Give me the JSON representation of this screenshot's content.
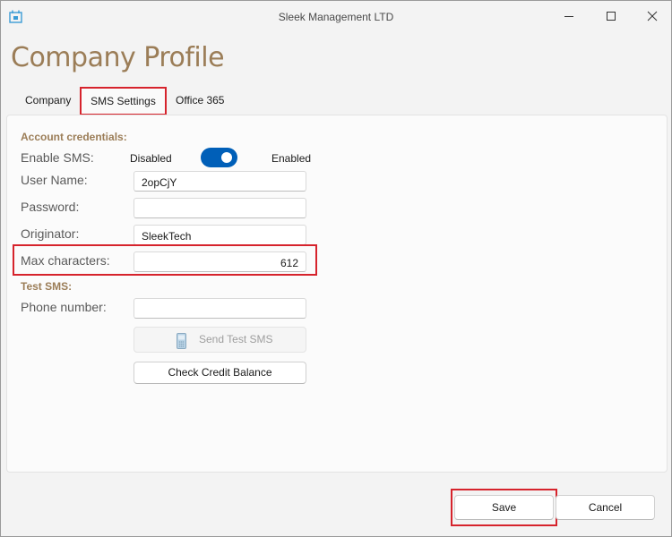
{
  "window": {
    "title": "Sleek Management LTD"
  },
  "page": {
    "title": "Company Profile"
  },
  "tabs": [
    {
      "label": "Company"
    },
    {
      "label": "SMS Settings",
      "selected": true
    },
    {
      "label": "Office 365"
    }
  ],
  "sms": {
    "account_section": "Account credentials:",
    "enable_label": "Enable SMS:",
    "toggle_off_label": "Disabled",
    "toggle_on_label": "Enabled",
    "toggle_state": "on",
    "username_label": "User Name:",
    "username_value": "2opCjY",
    "password_label": "Password:",
    "password_value": "",
    "originator_label": "Originator:",
    "originator_value": "SleekTech",
    "max_chars_label": "Max characters:",
    "max_chars_value": "612",
    "test_section": "Test SMS:",
    "phone_label": "Phone number:",
    "phone_value": "",
    "send_test_label": "Send Test SMS",
    "check_credit_label": "Check Credit Balance"
  },
  "footer": {
    "save_label": "Save",
    "cancel_label": "Cancel"
  },
  "colors": {
    "accent": "#9b7d57",
    "toggle_on": "#005fb8",
    "highlight": "#d6232c"
  },
  "icons": [
    "app-icon",
    "minimize-icon",
    "maximize-icon",
    "close-icon",
    "phone-icon"
  ]
}
